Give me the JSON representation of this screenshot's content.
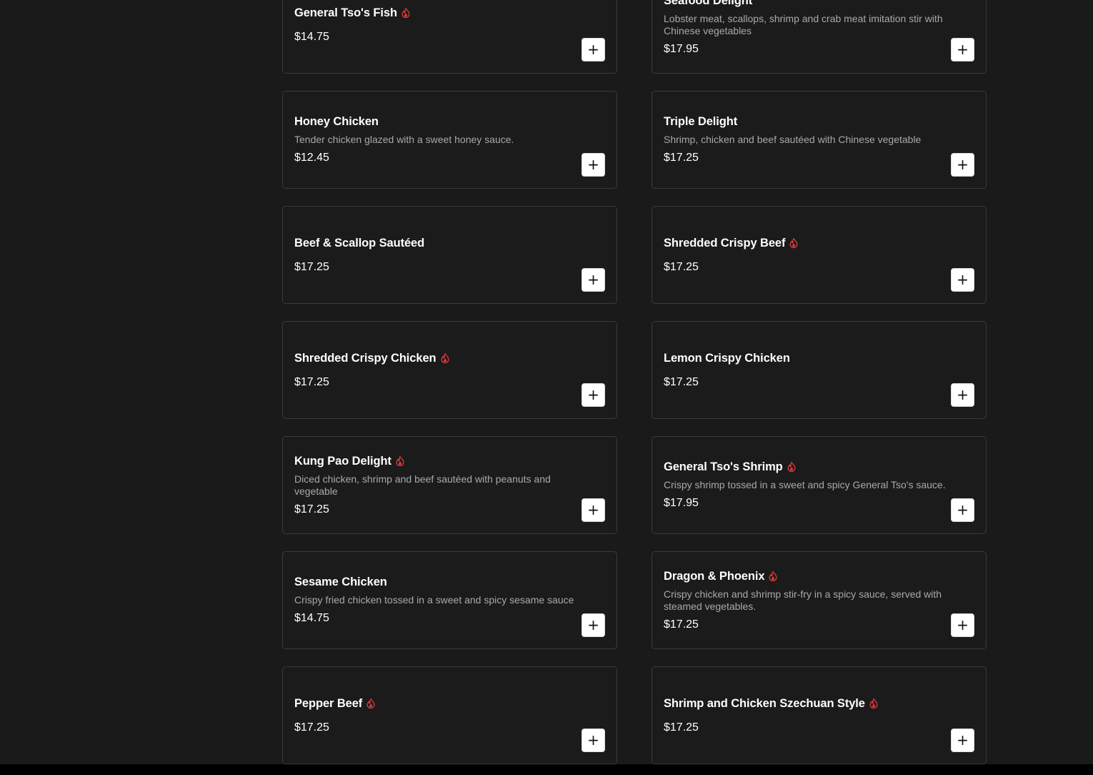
{
  "colors": {
    "background": "#1a1a1a",
    "card_border": "#3a3a3a",
    "text_primary": "#ffffff",
    "text_secondary": "#a9a9a9",
    "spicy": "#e0393e",
    "button_bg": "#ffffff"
  },
  "add_button_label": "+",
  "spicy_icon": "flame-icon",
  "menu": {
    "items": [
      {
        "name": "General Tso's Fish",
        "spicy": true,
        "description": "",
        "price": "$14.75"
      },
      {
        "name": "Seafood Delight",
        "spicy": false,
        "description": "Lobster meat, scallops, shrimp and crab meat imitation stir with Chinese vegetables",
        "price": "$17.95"
      },
      {
        "name": "Honey Chicken",
        "spicy": false,
        "description": "Tender chicken glazed with a sweet honey sauce.",
        "price": "$12.45"
      },
      {
        "name": "Triple Delight",
        "spicy": false,
        "description": "Shrimp, chicken and beef sautéed with Chinese vegetable",
        "price": "$17.25"
      },
      {
        "name": "Beef & Scallop Sautéed",
        "spicy": false,
        "description": "",
        "price": "$17.25"
      },
      {
        "name": "Shredded Crispy Beef",
        "spicy": true,
        "description": "",
        "price": "$17.25"
      },
      {
        "name": "Shredded Crispy Chicken",
        "spicy": true,
        "description": "",
        "price": "$17.25"
      },
      {
        "name": "Lemon Crispy Chicken",
        "spicy": false,
        "description": "",
        "price": "$17.25"
      },
      {
        "name": "Kung Pao Delight",
        "spicy": true,
        "description": "Diced chicken, shrimp and beef sautéed with peanuts and vegetable",
        "price": "$17.25"
      },
      {
        "name": "General Tso's Shrimp",
        "spicy": true,
        "description": "Crispy shrimp tossed in a sweet and spicy General Tso's sauce.",
        "price": "$17.95"
      },
      {
        "name": "Sesame Chicken",
        "spicy": false,
        "description": "Crispy fried chicken tossed in a sweet and spicy sesame sauce",
        "price": "$14.75"
      },
      {
        "name": "Dragon & Phoenix",
        "spicy": true,
        "description": "Crispy chicken and shrimp stir-fry in a spicy sauce, served with steamed vegetables.",
        "price": "$17.25"
      },
      {
        "name": "Pepper Beef",
        "spicy": true,
        "description": "",
        "price": "$17.25"
      },
      {
        "name": "Shrimp and Chicken Szechuan Style",
        "spicy": true,
        "description": "",
        "price": "$17.25"
      }
    ]
  }
}
